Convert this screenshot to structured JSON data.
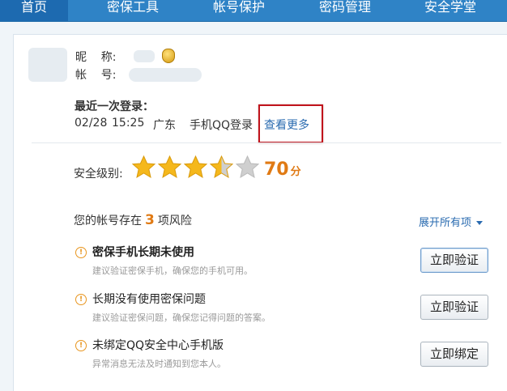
{
  "nav": {
    "items": [
      {
        "label": "首页",
        "active": true
      },
      {
        "label": "密保工具",
        "active": false
      },
      {
        "label": "帐号保护",
        "active": false
      },
      {
        "label": "密码管理",
        "active": false
      },
      {
        "label": "安全学堂",
        "active": false
      }
    ]
  },
  "profile": {
    "nickname_label": "昵    称:",
    "account_label": "帐    号:",
    "nickname_badge_icon": "shield-badge-icon"
  },
  "last_login": {
    "title": "最近一次登录：",
    "date": "02/28",
    "time": "15:25",
    "location": "广东",
    "method": "手机QQ登录",
    "more_link": "查看更多"
  },
  "security": {
    "level_label": "安全级别:",
    "stars_filled": 3.5,
    "stars_total": 5,
    "score": "70",
    "score_unit": "分",
    "colors": {
      "star_filled": "#f5b81c",
      "star_empty": "#cfcfcf",
      "score": "#e07a14"
    }
  },
  "risks": {
    "prefix": "您的帐号存在",
    "count": "3",
    "suffix": "项风险",
    "expand_label": "展开所有项",
    "items": [
      {
        "title": "密保手机长期未使用",
        "desc": "建议验证密保手机，确保您的手机可用。",
        "button": "立即验证",
        "icon": "warning-icon"
      },
      {
        "title": "长期没有使用密保问题",
        "desc": "建议验证密保问题，确保您记得问题的答案。",
        "button": "立即验证",
        "icon": "warning-icon"
      },
      {
        "title": "未绑定QQ安全中心手机版",
        "desc": "异常消息无法及时通知到您本人。",
        "button": "立即绑定",
        "icon": "warning-icon"
      }
    ]
  }
}
